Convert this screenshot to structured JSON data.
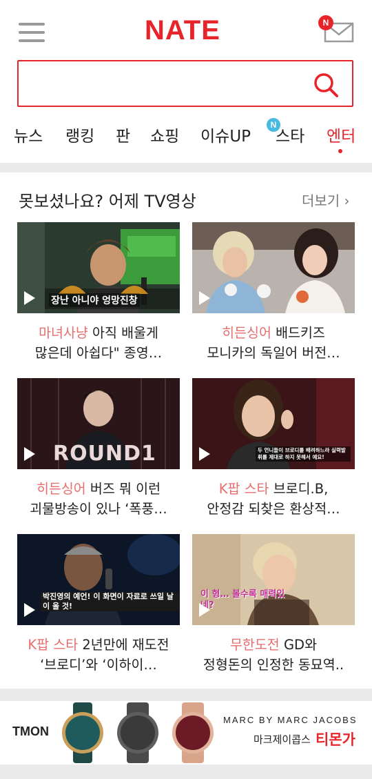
{
  "header": {
    "logo": "NATE",
    "mail_badge": "N"
  },
  "search": {
    "placeholder": ""
  },
  "nav": {
    "items": [
      "뉴스",
      "랭킹",
      "판",
      "쇼핑",
      "이슈UP",
      "스타",
      "엔터"
    ],
    "new_badge": "N",
    "active": "엔터"
  },
  "section": {
    "title": "못보셨나요? 어제 TV영상",
    "more": "더보기 ›"
  },
  "videos": [
    {
      "tag": "마녀사냥",
      "line1": " 아직 배울게",
      "line2": "많은데 아쉽다\" 종영…",
      "overlay": "장난 아니야 엉망진창"
    },
    {
      "tag": "히든싱어",
      "line1": " 배드키즈",
      "line2": "모니카의 독일어 버전…",
      "overlay": ""
    },
    {
      "tag": "히든싱어",
      "line1": " 버즈 뭐 이런",
      "line2": "괴물방송이 있나 ‘폭풍…",
      "overlay": "ROUND1"
    },
    {
      "tag": "K팝 스타",
      "line1": " 브로디.B,",
      "line2": "안정감 되찾은 환상적…",
      "overlay": "두 언니들이 브로디를 배려하느라 실력발휘를 제대로 하지 못해서 예요!"
    },
    {
      "tag": "K팝 스타",
      "line1": " 2년만에 재도전",
      "line2": "‘브로디’와 ‘이하이…",
      "overlay": "박진영의 예언! 이 화면이 자료로 쓰일 날이 올 것!"
    },
    {
      "tag": "무한도전",
      "line1": " GD와",
      "line2": "정형돈의 인정한 동묘역..",
      "overlay": "이 형… 볼수록 매력있네?"
    }
  ],
  "ad": {
    "left_brand": "TMON",
    "brand": "MARC BY MARC JACOBS",
    "label": "마크제이콥스",
    "store": "티몬가"
  },
  "colors": {
    "accent": "#e8242b",
    "tag": "#e86e6e",
    "badge_blue": "#48b9e0"
  }
}
